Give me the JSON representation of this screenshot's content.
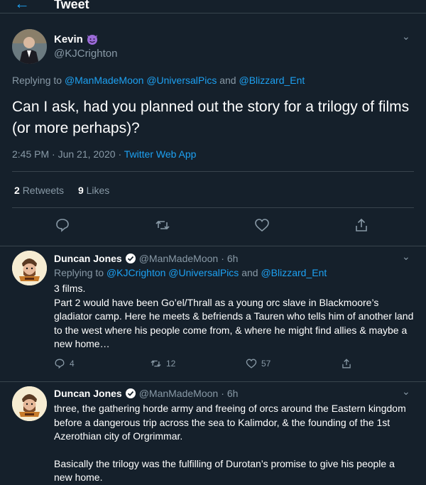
{
  "header": {
    "back_icon": "arrow-left-icon",
    "title": "Tweet"
  },
  "main_tweet": {
    "name": "Kevin",
    "emoji": "smiling-devil-icon",
    "handle": "@KJCrighton",
    "replying_prefix": "Replying to",
    "replying_to": [
      "@ManMadeMoon",
      "@UniversalPics",
      "@Blizzard_Ent"
    ],
    "replying_and": "and",
    "text": "Can I ask, had you planned out the story for a trilogy of films (or more perhaps)?",
    "timestamp": "2:45 PM · Jun 21, 2020",
    "source": "Twitter Web App",
    "retweets_count": "2",
    "retweets_label": "Retweets",
    "likes_count": "9",
    "likes_label": "Likes"
  },
  "replies": [
    {
      "name": "Duncan Jones",
      "verified": true,
      "handle": "@ManMadeMoon",
      "time": "6h",
      "replying_prefix": "Replying to",
      "replying_to": [
        "@KJCrighton",
        "@UniversalPics",
        "@Blizzard_Ent"
      ],
      "replying_and": "and",
      "paragraphs": [
        "3 films.",
        "Part 2 would have been Go’el/Thrall as a young orc slave in Blackmoore’s gladiator camp. Here he meets & befriends a Tauren who tells him of another land to the west where his people come from, & where he might find allies & maybe a new home…"
      ],
      "reply_count": "4",
      "retweet_count": "12",
      "like_count": "57"
    },
    {
      "name": "Duncan Jones",
      "verified": true,
      "handle": "@ManMadeMoon",
      "time": "6h",
      "paragraphs": [
        "three, the gathering horde army and freeing of orcs around the Eastern kingdom before a dangerous trip across the sea to Kalimdor, & the founding of the 1st Azerothian city of Orgrimmar.",
        "Basically the trilogy was the fulfilling of Durotan’s promise to give his people a new home."
      ]
    }
  ],
  "colors": {
    "background": "#15202b",
    "accent": "#1da1f2",
    "secondary_text": "#8899a6",
    "divider": "#38444d"
  }
}
